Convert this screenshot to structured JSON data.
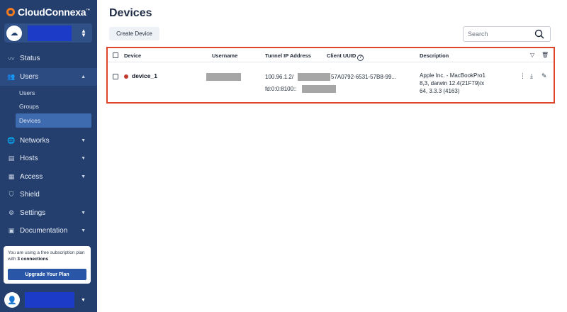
{
  "app": {
    "brand_name": "CloudConnexa",
    "brand_tm": "™"
  },
  "sidebar": {
    "workspace_icon": "cloud-icon",
    "items": [
      {
        "label": "Status",
        "icon": "activity-icon"
      },
      {
        "label": "Users",
        "icon": "users-icon",
        "expanded": true
      },
      {
        "label": "Networks",
        "icon": "globe-icon"
      },
      {
        "label": "Hosts",
        "icon": "server-icon"
      },
      {
        "label": "Access",
        "icon": "grid-icon"
      },
      {
        "label": "Shield",
        "icon": "shield-icon"
      },
      {
        "label": "Settings",
        "icon": "gear-icon"
      },
      {
        "label": "Documentation",
        "icon": "doc-icon"
      }
    ],
    "users_sub": [
      {
        "label": "Users"
      },
      {
        "label": "Groups"
      },
      {
        "label": "Devices",
        "active": true
      }
    ],
    "plan": {
      "text_prefix": "You are using a free subscription plan with",
      "connections": "3 connections",
      "upgrade_label": "Upgrade Your Plan"
    }
  },
  "main": {
    "title": "Devices",
    "create_label": "Create Device",
    "search_placeholder": "Search",
    "table": {
      "headers": {
        "device": "Device",
        "username": "Username",
        "tunnel_ip": "Tunnel IP Address",
        "client_uuid": "Client UUID",
        "description": "Description"
      },
      "rows": [
        {
          "device": "device_1",
          "status_color": "#c0392b",
          "ip_v4_prefix": "100.96.1.2/",
          "uuid_suffix": "57A0792-6531-57B8-99...",
          "ip_v6_prefix": "fd:0:0:8100::",
          "description_lines": [
            "Apple Inc. - MacBookPro1",
            "8,3, darwin 12.4(21F79)/x",
            "64, 3.3.3 (4163)"
          ]
        }
      ]
    }
  },
  "colors": {
    "sidebar_bg": "#243f6e",
    "highlight": "#e0452c",
    "accent_button": "#2a56a8"
  }
}
